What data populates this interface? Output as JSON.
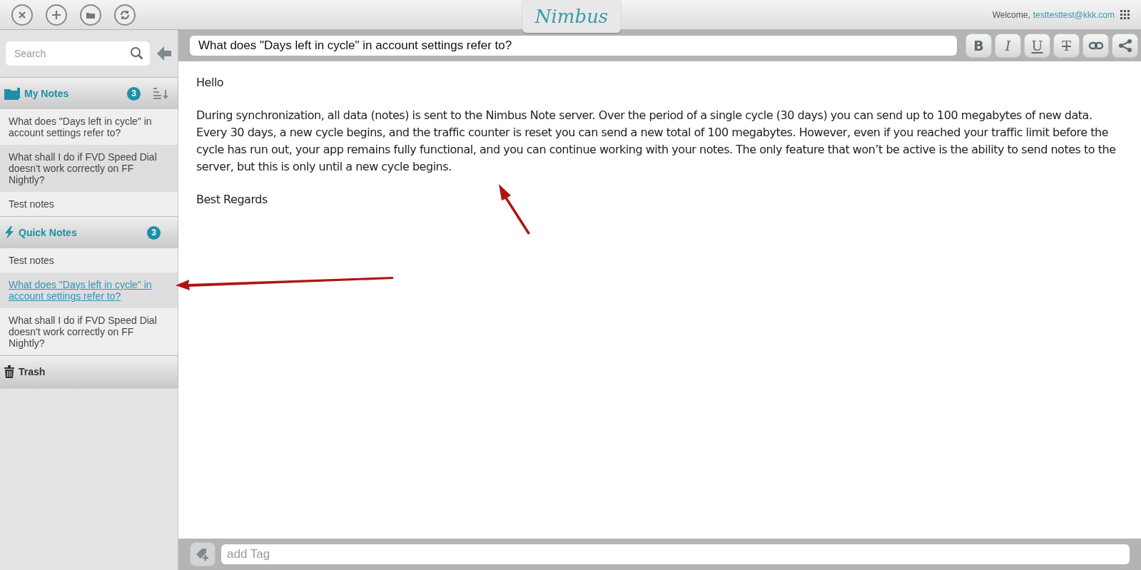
{
  "toolbar": {
    "buttons": [
      {
        "kind": "close"
      },
      {
        "kind": "add"
      },
      {
        "kind": "folder"
      },
      {
        "kind": "sync"
      }
    ],
    "logo": "Nimbus",
    "welcome": "Welcome,",
    "user": "testtesttest@kkk.com"
  },
  "sidebar": {
    "search": {
      "placeholder": "Search"
    },
    "sections": [
      {
        "kind": "folder",
        "title": "My Notes",
        "count": "3",
        "sort": true,
        "notes": [
          {
            "title": "What does \"Days left in cycle\" in account settings refer to?",
            "selected": false
          },
          {
            "title": "What shall I do if FVD Speed Dial doesn't work correctly on FF Nightly?",
            "selected": false
          },
          {
            "title": "Test notes",
            "selected": false
          }
        ]
      },
      {
        "kind": "quick",
        "title": "Quick Notes",
        "count": "3",
        "sort": false,
        "notes": [
          {
            "title": "Test notes",
            "selected": false
          },
          {
            "title": "What does \"Days left in cycle\" in account settings refer to?",
            "selected": true
          },
          {
            "title": "What shall I do if FVD Speed Dial doesn't work correctly on FF Nightly?",
            "selected": false
          }
        ]
      },
      {
        "kind": "trash",
        "title": "Trash",
        "sort": false
      }
    ]
  },
  "editor": {
    "title": "What does \"Days left in cycle\" in account settings refer to?",
    "format_buttons": [
      {
        "kind": "bold",
        "label": "B"
      },
      {
        "kind": "italic",
        "label": "I"
      },
      {
        "kind": "underline",
        "label": "U"
      },
      {
        "kind": "strike",
        "label": "T"
      },
      {
        "kind": "link"
      },
      {
        "kind": "share"
      }
    ],
    "paragraphs": [
      "Hello",
      "During synchronization, all data (notes) is sent to the Nimbus Note server. Over the period of a single cycle (30 days) you can send up to 100 megabytes of new data. Every 30 days, a new cycle begins, and the traffic counter is reset you can send a new total of 100 megabytes. However, even if you reached your traffic limit before the cycle has run out, your app remains fully functional, and you can continue working with your notes. The only feature that won’t be active is the ability to send notes to the server, but this is only until a new cycle begins.",
      "Best Regards"
    ],
    "tag_field": {
      "placeholder": "add Tag"
    }
  }
}
